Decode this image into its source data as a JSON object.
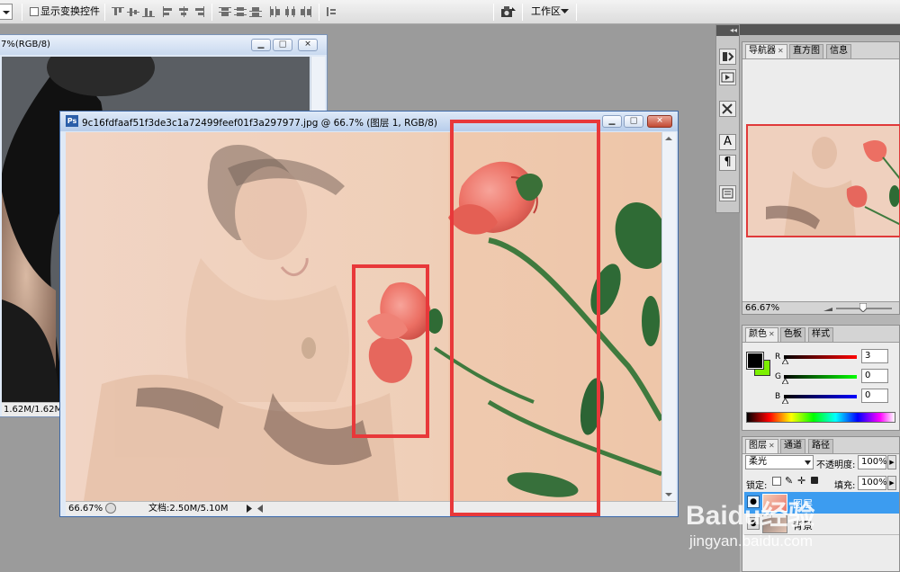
{
  "options_bar": {
    "show_transform_controls_label": "显示变换控件",
    "workspace_label": "工作区"
  },
  "back_window": {
    "title_fragment": "7%(RGB/8)",
    "doc_size": "1.62M/1.62M"
  },
  "front_window": {
    "title": "9c16fdfaaf51f3de3c1a72499feef01f3a297977.jpg @ 66.7% (图层 1, RGB/8)",
    "zoom": "66.67%",
    "doc_info": "文档:2.50M/5.10M"
  },
  "navigator": {
    "tabs": [
      "导航器",
      "直方图",
      "信息"
    ],
    "zoom": "66.67%"
  },
  "color_panel": {
    "tabs": [
      "颜色",
      "色板",
      "样式"
    ],
    "channels": [
      {
        "label": "R",
        "value": "3"
      },
      {
        "label": "G",
        "value": "0"
      },
      {
        "label": "B",
        "value": "0"
      }
    ],
    "colors": {
      "foreground": "#000000",
      "background": "#7cf000"
    }
  },
  "layers_panel": {
    "tabs": [
      "图层",
      "通道",
      "路径"
    ],
    "blend_mode": "柔光",
    "opacity_label": "不透明度:",
    "opacity_value": "100%",
    "lock_label": "锁定:",
    "fill_label": "填充:",
    "fill_value": "100%",
    "layers": [
      {
        "name": "图层",
        "selected": true
      },
      {
        "name": "背景",
        "selected": false
      }
    ]
  },
  "watermark": {
    "brand": "Baidu经验",
    "url": "jingyan.baidu.com"
  },
  "colors": {
    "annotation": "#e8383a",
    "selection": "#3c9cf0"
  }
}
